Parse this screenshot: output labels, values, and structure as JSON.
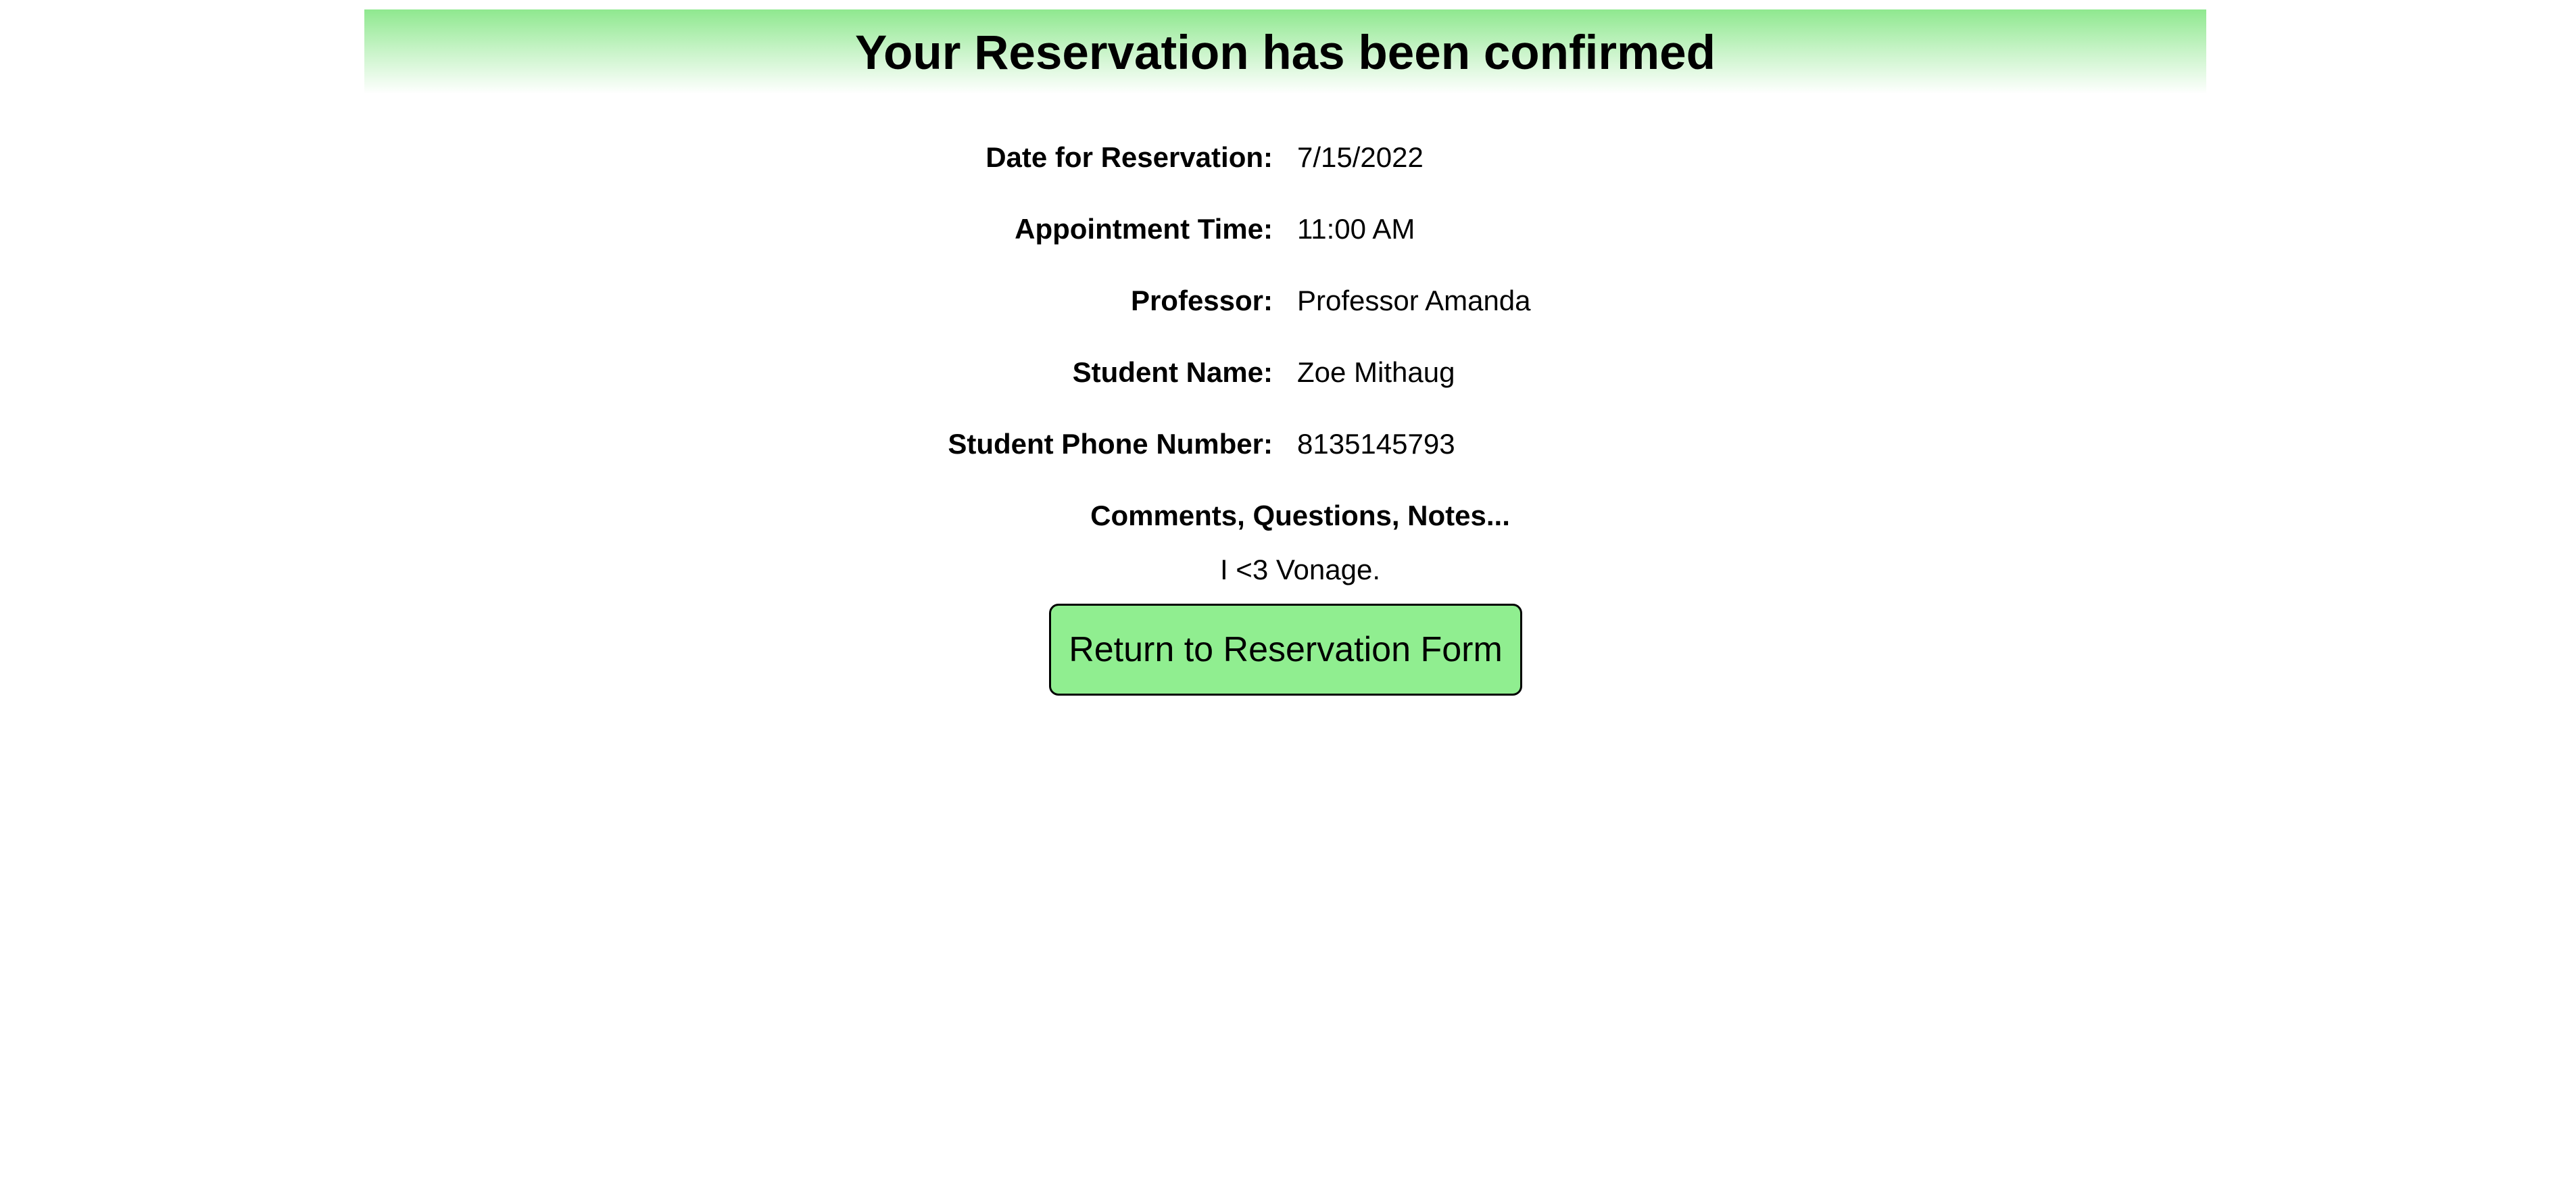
{
  "header": {
    "title": "Your Reservation has been confirmed"
  },
  "details": [
    {
      "label": "Date for Reservation:",
      "value": "7/15/2022"
    },
    {
      "label": "Appointment Time:",
      "value": "11:00 AM"
    },
    {
      "label": "Professor:",
      "value": "Professor Amanda"
    },
    {
      "label": "Student Name:",
      "value": "Zoe Mithaug"
    },
    {
      "label": "Student Phone Number:",
      "value": "8135145793"
    }
  ],
  "comments": {
    "heading": "Comments, Questions, Notes...",
    "text": "I <3 Vonage."
  },
  "actions": {
    "return_label": "Return to Reservation Form"
  },
  "colors": {
    "banner_green": "#8fe88f",
    "button_green": "#90ee90"
  }
}
